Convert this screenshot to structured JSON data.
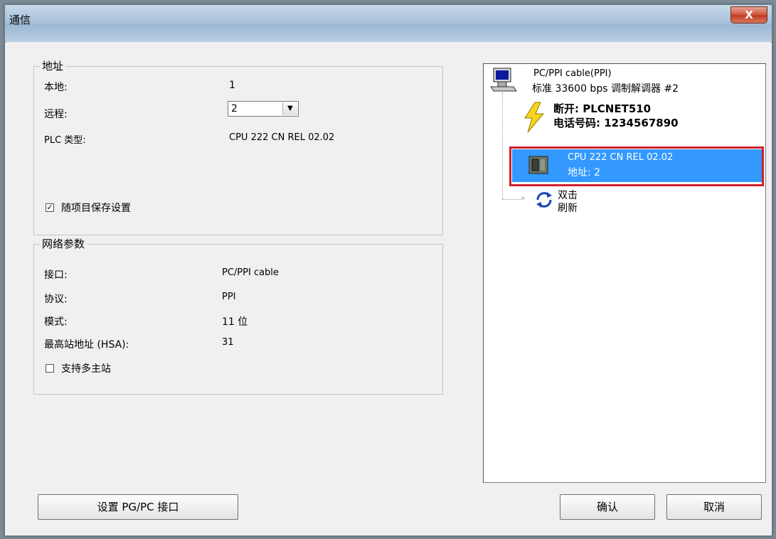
{
  "window": {
    "title": "通信",
    "close_label": "X"
  },
  "address_group": {
    "legend": "地址",
    "local_label": "本地:",
    "local_value": "1",
    "remote_label": "远程:",
    "remote_value": "2",
    "plc_type_label": "PLC 类型:",
    "plc_type_value": "CPU 222 CN REL 02.02",
    "save_settings_label": "随项目保存设置",
    "save_settings_checked": true
  },
  "network_group": {
    "legend": "网络参数",
    "interface_label": "接口:",
    "interface_value": "PC/PPI cable",
    "protocol_label": "协议:",
    "protocol_value": "PPI",
    "mode_label": "模式:",
    "mode_value": "11 位",
    "hsa_label": "最高站地址 (HSA):",
    "hsa_value": "31",
    "multi_master_label": "支持多主站",
    "multi_master_checked": false
  },
  "tree": {
    "cable_line1": "PC/PPI cable(PPI)",
    "cable_line2": "标准 33600 bps 调制解调器 #2",
    "disconnect_line": "断开: PLCNET510",
    "phone_line": "电话号码: 1234567890",
    "cpu_line": "CPU 222 CN REL 02.02",
    "address_line": "地址: 2",
    "refresh_line1": "双击",
    "refresh_line2": "刷新"
  },
  "buttons": {
    "set_interface": "设置 PG/PC 接口",
    "ok": "确认",
    "cancel": "取消"
  }
}
